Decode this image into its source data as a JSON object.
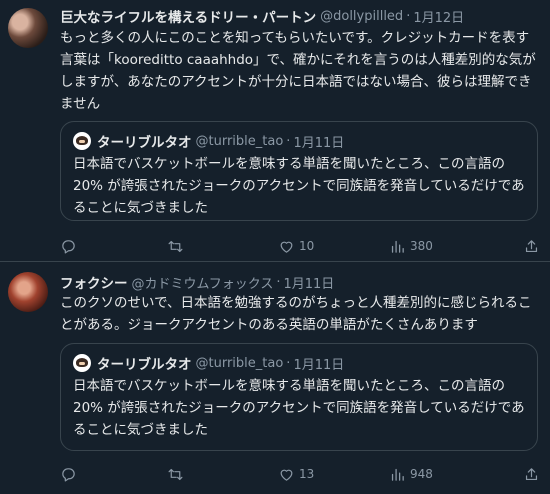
{
  "tweets": [
    {
      "author_name": "巨大なライフルを構えるドリー・パートン",
      "handle": "@dollypillled",
      "separator": "·",
      "date": "1月12日",
      "body": "もっと多くの人にこのことを知ってもらいたいです。クレジットカードを表す言葉は「kooreditto caaahhdo」で、確かにそれを言うのは人種差別的な気がしますが、あなたのアクセントが十分に日本語ではない場合、彼らは理解できません",
      "quote": {
        "author_name": "ターリブルタオ",
        "handle": "@turrible_tao",
        "separator": "·",
        "date": "1月11日",
        "body": "日本語でバスケットボールを意味する単語を聞いたところ、この言語の 20% が誇張されたジョークのアクセントで同族語を発音しているだけであることに気づきました"
      },
      "counts": {
        "replies": "",
        "retweets": "",
        "likes": "10",
        "views": "380"
      }
    },
    {
      "author_name": "フォクシー",
      "handle": "@カドミウムフォックス",
      "separator": "·",
      "date": "1月11日",
      "body": "このクソのせいで、日本語を勉強するのがちょっと人種差別的に感じられることがある。ジョークアクセントのある英語の単語がたくさんあります",
      "quote": {
        "author_name": "ターリブルタオ",
        "handle": "@turrible_tao",
        "separator": "·",
        "date": "1月11日",
        "body": "日本語でバスケットボールを意味する単語を聞いたところ、この言語の 20% が誇張されたジョークのアクセントで同族語を発音しているだけであることに気づきました"
      },
      "counts": {
        "replies": "",
        "retweets": "",
        "likes": "13",
        "views": "948"
      }
    }
  ],
  "icons": [
    "reply-icon",
    "retweet-icon",
    "like-icon",
    "views-icon",
    "share-icon"
  ],
  "colors": {
    "background": "#15202b",
    "text": "#e7e9ea",
    "muted": "#8b98a5",
    "border": "#38444d"
  }
}
